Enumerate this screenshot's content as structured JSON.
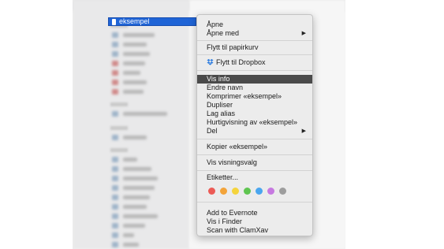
{
  "finder": {
    "selected_file": "eksempel",
    "bg_rows": [
      {
        "w": 40
      },
      {
        "w": 30
      },
      {
        "w": 34
      },
      {
        "w": 28
      },
      {
        "w": 22
      },
      {
        "w": 30
      },
      {
        "w": 26
      },
      {
        "w": 24
      }
    ]
  },
  "menu": {
    "items": {
      "open": "Åpne",
      "open_with": "Åpne med",
      "move_to_trash": "Flytt til papirkurv",
      "move_to_dropbox": "Flytt til Dropbox",
      "get_info": "Vis info",
      "rename": "Endre navn",
      "compress": "Komprimer «eksempel»",
      "duplicate": "Dupliser",
      "make_alias": "Lag alias",
      "quick_look": "Hurtigvisning av «eksempel»",
      "share": "Del",
      "copy": "Kopier «eksempel»",
      "show_view_options": "Vis visningsvalg",
      "tags": "Etiketter...",
      "add_to_evernote": "Add to Evernote",
      "show_in_finder": "Vis i Finder",
      "scan_clamxav": "Scan with ClamXav"
    },
    "tag_colors": [
      "#ec5b56",
      "#f3a43a",
      "#f5d43c",
      "#5fc550",
      "#4aa6ef",
      "#c679e0",
      "#9d9d9d"
    ]
  }
}
